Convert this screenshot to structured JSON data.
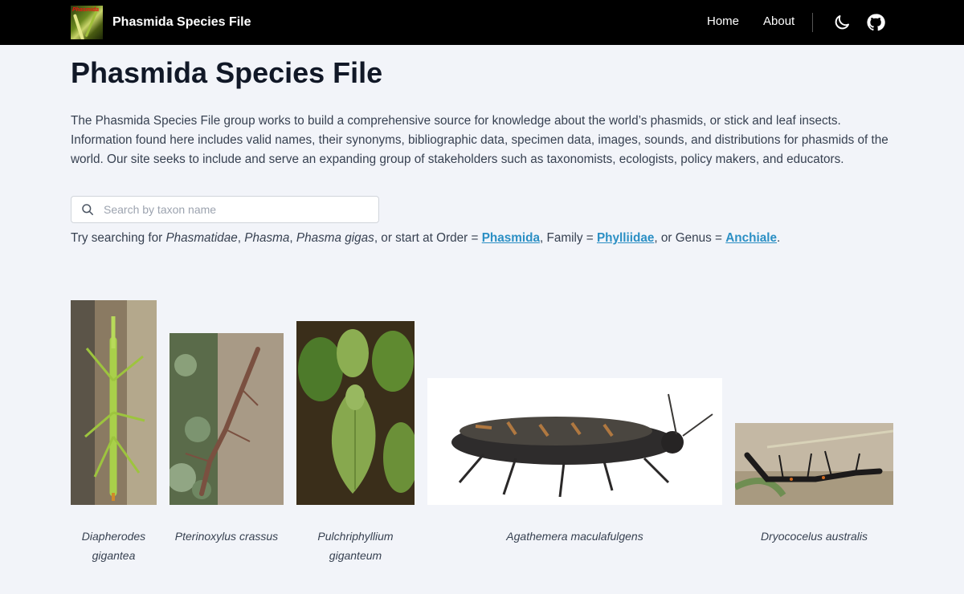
{
  "nav": {
    "brand": "Phasmida Species File",
    "links": [
      "Home",
      "About"
    ],
    "icons": [
      "moon-icon",
      "github-icon"
    ]
  },
  "page": {
    "title": "Phasmida Species File",
    "intro": "The Phasmida Species File group works to build a comprehensive source for knowledge about the world’s phasmids, or stick and leaf insects. Information found here includes valid names, their synonyms, bibliographic data, specimen data, images, sounds, and distributions for phasmids of the world. Our site seeks to include and serve an expanding group of stakeholders such as taxonomists, ecologists, policy makers, and educators."
  },
  "search": {
    "placeholder": "Search by taxon name",
    "value": ""
  },
  "hint": {
    "prefix": "Try searching for ",
    "example1": "Phasmatidae",
    "sep1": ", ",
    "example2": "Phasma",
    "sep2": ", ",
    "example3": "Phasma gigas",
    "middle": ", or start at Order = ",
    "order_link": "Phasmida",
    "family_prefix": ", Family = ",
    "family_link": "Phylliidae",
    "genus_prefix": ", or Genus = ",
    "genus_link": "Anchiale",
    "suffix": "."
  },
  "gallery": [
    {
      "caption": "Diapherodes gigantea"
    },
    {
      "caption": "Pterinoxylus crassus"
    },
    {
      "caption": "Pulchriphyllium giganteum"
    },
    {
      "caption": "Agathemera maculafulgens"
    },
    {
      "caption": "Dryococelus australis"
    }
  ],
  "colors": {
    "navbar": "#000000",
    "background": "#f2f4f9",
    "link": "#2b8fc4",
    "title": "#111827"
  }
}
